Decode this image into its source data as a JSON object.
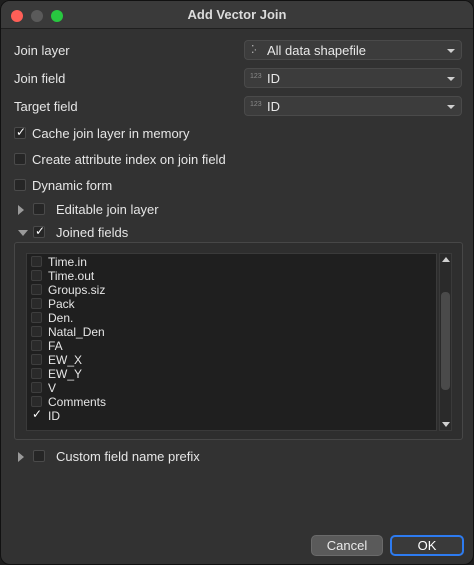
{
  "window": {
    "title": "Add Vector Join"
  },
  "form": {
    "join_layer_label": "Join layer",
    "join_layer_value": "All data shapefile",
    "join_field_label": "Join field",
    "join_field_value": "ID",
    "join_field_type": "123",
    "target_field_label": "Target field",
    "target_field_value": "ID",
    "target_field_type": "123"
  },
  "options": {
    "cache": {
      "label": "Cache join layer in memory",
      "checked": true
    },
    "attr_index": {
      "label": "Create attribute index on join field",
      "checked": false
    },
    "dynamic_form": {
      "label": "Dynamic form",
      "checked": false
    },
    "editable": {
      "label": "Editable join layer",
      "checked": false,
      "expanded": false
    },
    "joined_fields": {
      "label": "Joined fields",
      "checked": true,
      "expanded": true
    },
    "prefix": {
      "label": "Custom field name prefix",
      "checked": false,
      "expanded": false
    }
  },
  "joined_fields_list": [
    {
      "name": "Time.in",
      "checked": false
    },
    {
      "name": "Time.out",
      "checked": false
    },
    {
      "name": "Groups.siz",
      "checked": false
    },
    {
      "name": "Pack",
      "checked": false
    },
    {
      "name": "Den.",
      "checked": false
    },
    {
      "name": "Natal_Den",
      "checked": false
    },
    {
      "name": "FA",
      "checked": false
    },
    {
      "name": "EW_X",
      "checked": false
    },
    {
      "name": "EW_Y",
      "checked": false
    },
    {
      "name": "V",
      "checked": false
    },
    {
      "name": "Comments",
      "checked": false
    },
    {
      "name": "ID",
      "checked": true
    }
  ],
  "buttons": {
    "cancel": "Cancel",
    "ok": "OK"
  },
  "colors": {
    "accent": "#2d7bf0"
  }
}
